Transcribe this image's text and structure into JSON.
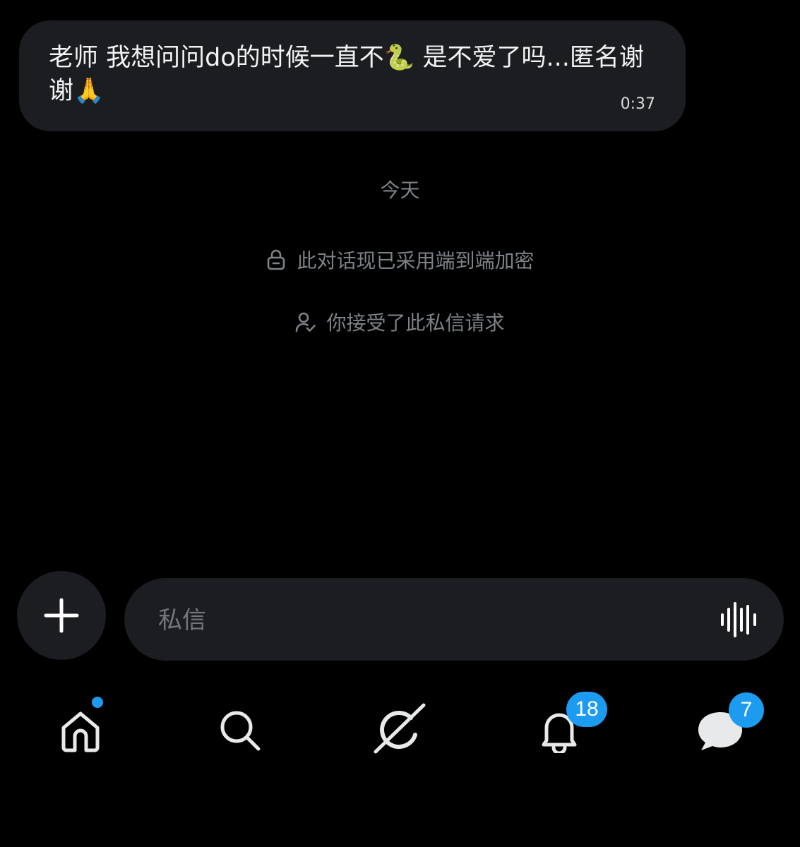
{
  "message": {
    "text": "老师 我想问问do的时候一直不🐍 是不爱了吗...匿名谢谢🙏",
    "time": "0:37"
  },
  "system": {
    "date_label": "今天",
    "encryption_notice": "此对话现已采用端到端加密",
    "accepted_notice": "你接受了此私信请求"
  },
  "composer": {
    "placeholder": "私信"
  },
  "nav": {
    "home_icon": "home-icon",
    "search_icon": "search-icon",
    "grok_icon": "grok-icon",
    "notifications_icon": "bell-icon",
    "notifications_badge": "18",
    "messages_icon": "chat-bubble-icon",
    "messages_badge": "7"
  },
  "colors": {
    "background": "#000000",
    "bubble": "#1c1d20",
    "muted_text": "#7d8287",
    "badge": "#1d9bf0"
  }
}
